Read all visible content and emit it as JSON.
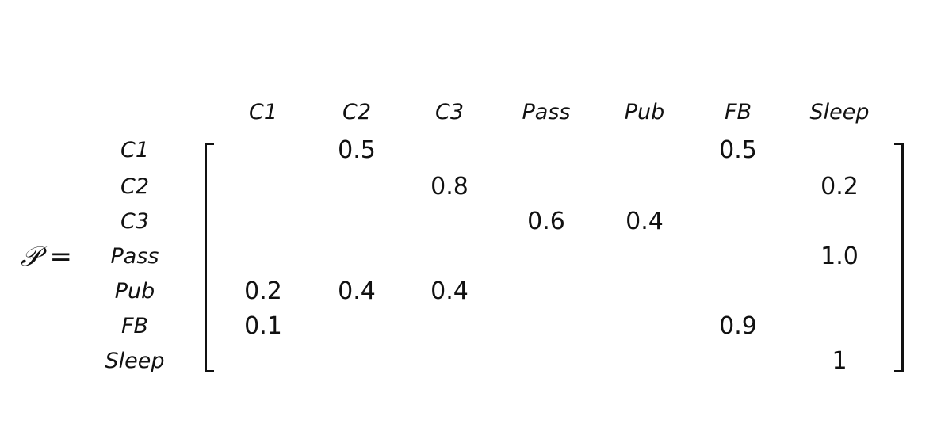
{
  "lhs": {
    "symbol": "𝒫",
    "equals": "="
  },
  "columns": [
    "C1",
    "C2",
    "C3",
    "Pass",
    "Pub",
    "FB",
    "Sleep"
  ],
  "rows": [
    {
      "label": "C1",
      "cells": [
        "",
        "0.5",
        "",
        "",
        "",
        "0.5",
        ""
      ]
    },
    {
      "label": "C2",
      "cells": [
        "",
        "",
        "0.8",
        "",
        "",
        "",
        "0.2"
      ]
    },
    {
      "label": "C3",
      "cells": [
        "",
        "",
        "",
        "0.6",
        "0.4",
        "",
        ""
      ]
    },
    {
      "label": "Pass",
      "cells": [
        "",
        "",
        "",
        "",
        "",
        "",
        "1.0"
      ]
    },
    {
      "label": "Pub",
      "cells": [
        "0.2",
        "0.4",
        "0.4",
        "",
        "",
        "",
        ""
      ]
    },
    {
      "label": "FB",
      "cells": [
        "0.1",
        "",
        "",
        "",
        "",
        "0.9",
        ""
      ]
    },
    {
      "label": "Sleep",
      "cells": [
        "",
        "",
        "",
        "",
        "",
        "",
        "1"
      ]
    }
  ]
}
